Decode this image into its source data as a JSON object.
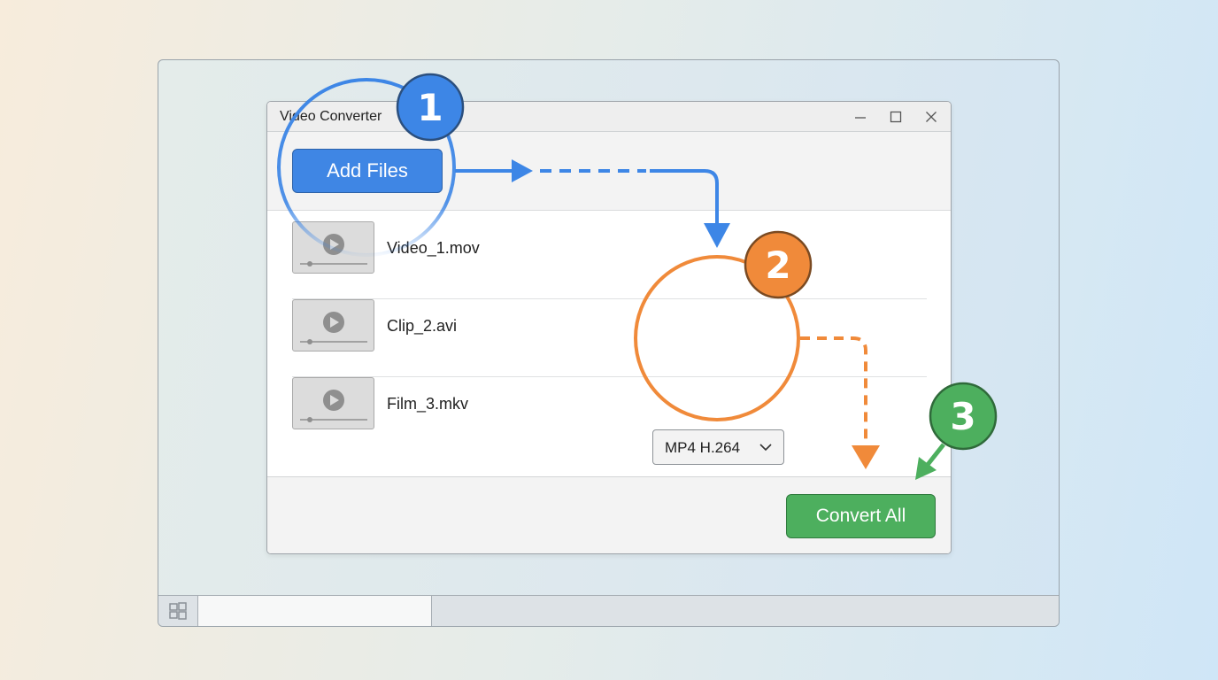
{
  "window": {
    "title": "Video Converter",
    "controls": [
      "minimize-icon",
      "maximize-icon",
      "close-icon"
    ]
  },
  "toolbar": {
    "add_files_label": "Add Files"
  },
  "files": [
    {
      "name": "Video_1.mov",
      "icon": "video-thumbnail-icon"
    },
    {
      "name": "Clip_2.avi",
      "icon": "video-thumbnail-icon"
    },
    {
      "name": "Film_3.mkv",
      "icon": "video-thumbnail-icon"
    }
  ],
  "format_select": {
    "value": "MP4 H.264",
    "icon": "chevron-down-icon"
  },
  "footer": {
    "convert_all_label": "Convert All"
  },
  "steps": [
    {
      "number": "1",
      "color": "#3d86e6"
    },
    {
      "number": "2",
      "color": "#f08a3a"
    },
    {
      "number": "3",
      "color": "#4daf5e"
    }
  ],
  "taskbar": {
    "start_icon": "windows-logo-icon"
  },
  "colors": {
    "primary_blue": "#3f86e4",
    "highlight_orange": "#f08a3a",
    "success_green": "#4daf5e"
  }
}
